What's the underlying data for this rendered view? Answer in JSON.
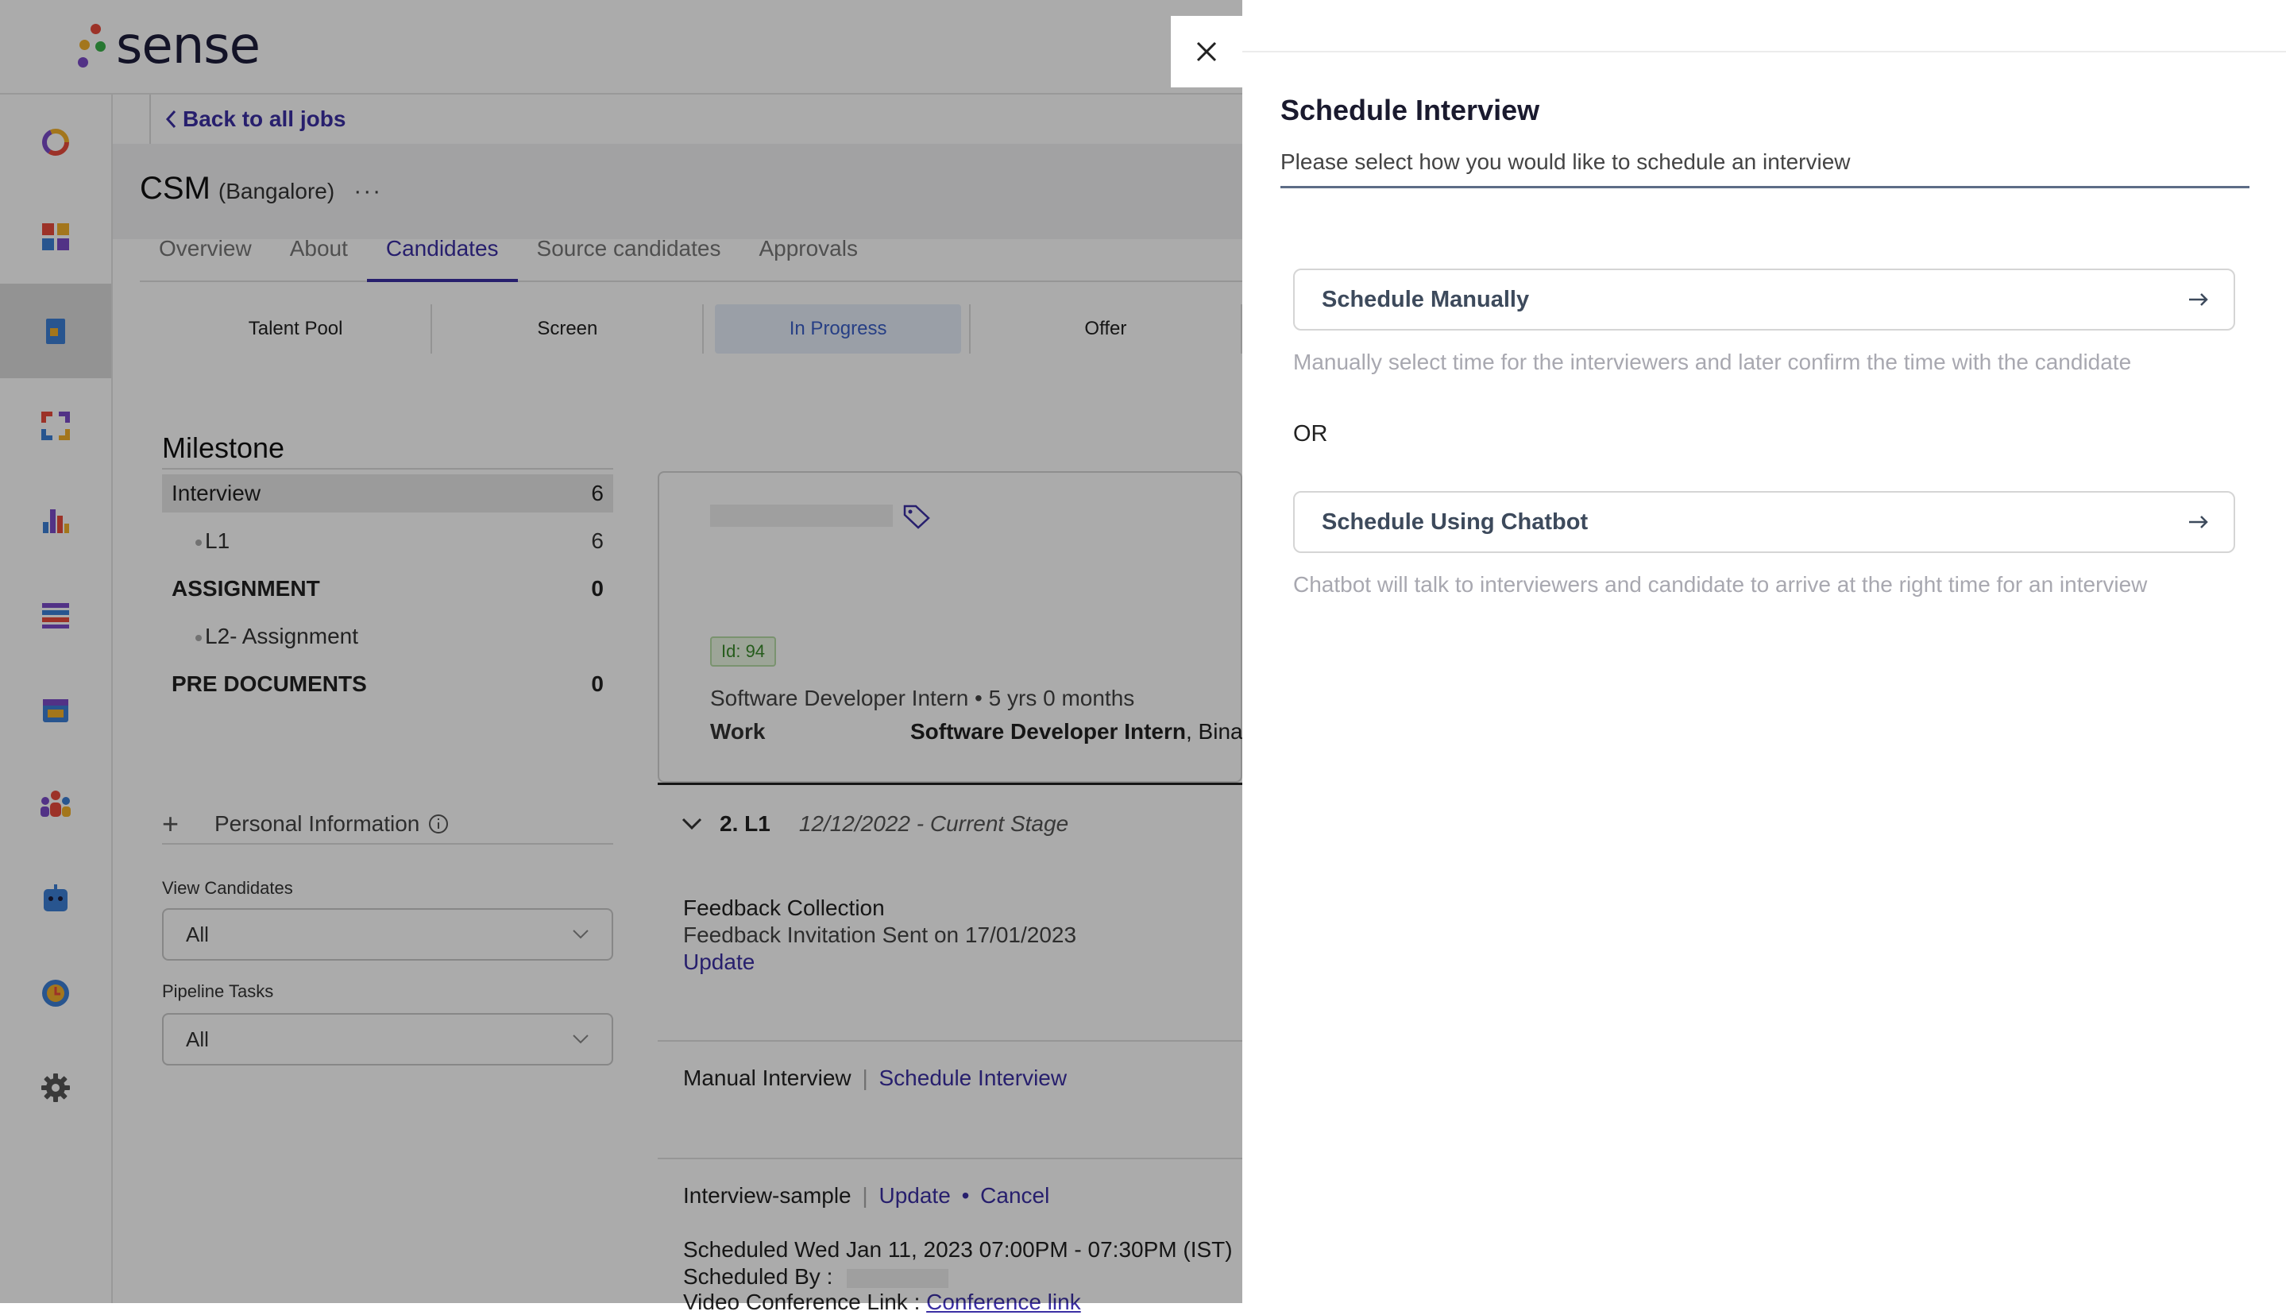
{
  "app": {
    "logo_text": "sense"
  },
  "header": {
    "back_label": "Back to all jobs"
  },
  "job": {
    "title": "CSM",
    "location": "(Bangalore)",
    "more": "···"
  },
  "tabs": [
    "Overview",
    "About",
    "Candidates",
    "Source candidates",
    "Approvals"
  ],
  "active_tab": "Candidates",
  "stages": [
    "Talent Pool",
    "Screen",
    "In Progress",
    "Offer"
  ],
  "milestones": {
    "title": "Milestone",
    "items": [
      {
        "label": "Interview",
        "count": "6"
      },
      {
        "label": "L1",
        "count": "6"
      },
      {
        "label": "ASSIGNMENT",
        "count": "0"
      },
      {
        "label": "L2- Assignment",
        "count": ""
      },
      {
        "label": "PRE DOCUMENTS",
        "count": "0"
      }
    ]
  },
  "personal_info": {
    "label": "Personal Information",
    "plus": "+"
  },
  "filters": {
    "view_candidates": {
      "label": "View Candidates",
      "value": "All"
    },
    "pipeline_tasks": {
      "label": "Pipeline Tasks",
      "value": "All"
    }
  },
  "candidate": {
    "id_badge": "Id: 94",
    "role_line": "Software Developer Intern • 5 yrs 0 months",
    "work_label": "Work",
    "work_role": "Software Developer Intern",
    "work_company": ", Binary"
  },
  "stage_detail": {
    "name": "2. L1",
    "date": "12/12/2022 - Current Stage",
    "feedback_title": "Feedback Collection",
    "feedback_sent": "Feedback Invitation Sent on 17/01/2023",
    "update": "Update",
    "manual_interview": "Manual Interview",
    "schedule_interview": "Schedule Interview",
    "sample_name": "Interview-sample",
    "sample_update": "Update",
    "sample_cancel": "Cancel",
    "scheduled_time": "Scheduled Wed Jan 11, 2023 07:00PM - 07:30PM (IST)",
    "scheduled_by": "Scheduled By :",
    "video_label": "Video Conference Link :",
    "video_link": "Conference link"
  },
  "panel": {
    "title": "Schedule Interview",
    "subtitle": "Please select how you would like to schedule an interview",
    "manual": {
      "label": "Schedule Manually",
      "desc": "Manually select time for the interviewers and later confirm the time with the candidate"
    },
    "or": "OR",
    "chatbot": {
      "label": "Schedule Using Chatbot",
      "desc": "Chatbot will talk to interviewers and candidate to arrive at the right time for an interview"
    },
    "close_icon": "close-icon",
    "arrow_icon": "arrow-right-icon"
  },
  "colors": {
    "accent": "#3b2fa3",
    "overlay": "rgba(0,0,0,0.33)",
    "id_badge": "#3a8a2a"
  }
}
